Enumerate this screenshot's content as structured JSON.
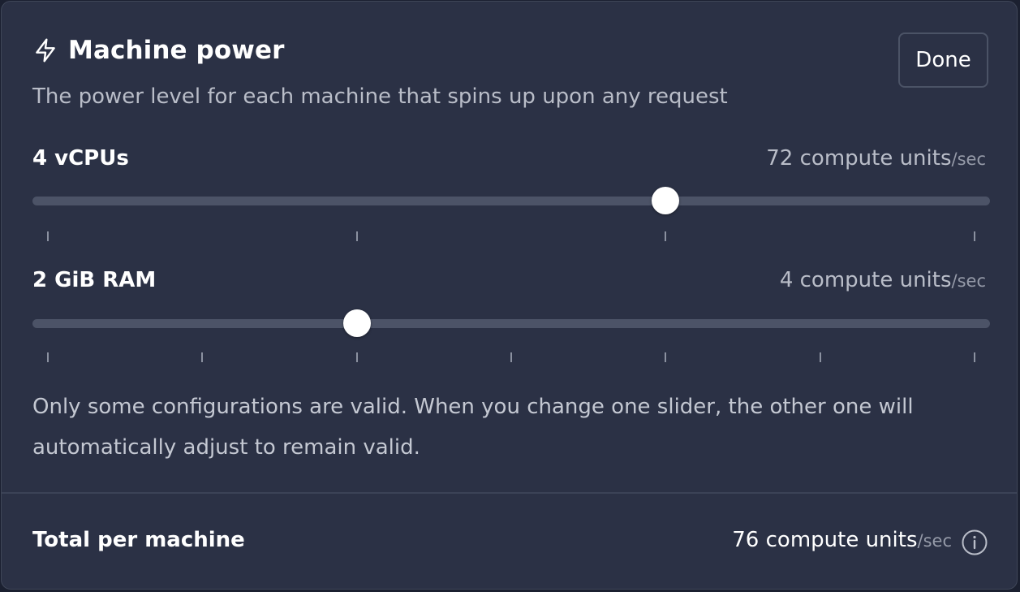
{
  "header": {
    "title": "Machine power",
    "icon": "bolt-icon",
    "subtitle": "The power level for each machine that spins up upon any request",
    "done_label": "Done"
  },
  "cpu_slider": {
    "label": "4 vCPUs",
    "units": "72 compute units",
    "per": "/sec",
    "tick_count": 4,
    "selected_index": 2
  },
  "ram_slider": {
    "label": "2 GiB RAM",
    "units": "4 compute units",
    "per": "/sec",
    "tick_count": 7,
    "selected_index": 2
  },
  "note": "Only some configurations are valid. When you change one slider, the other one will automatically adjust to remain valid.",
  "total": {
    "label": "Total per machine",
    "units": "76 compute units",
    "per": "/sec",
    "icon": "info-icon"
  },
  "colors": {
    "panel_bg": "#2b3145",
    "track": "#4c5367",
    "thumb": "#ffffff",
    "text_primary": "#ffffff",
    "text_secondary": "#b9bdc8"
  }
}
